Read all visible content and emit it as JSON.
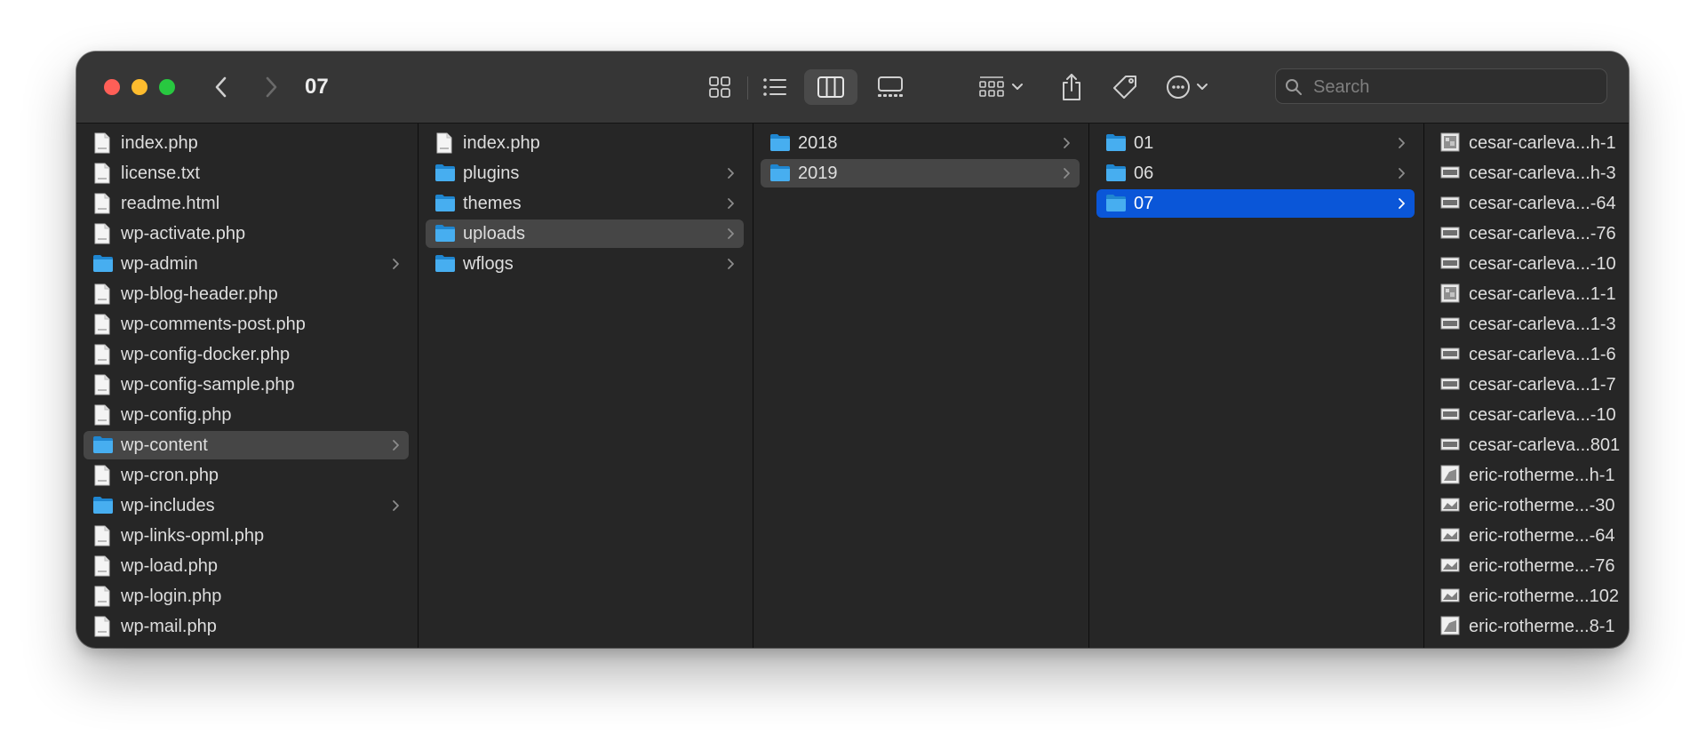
{
  "window": {
    "title": "07"
  },
  "search": {
    "placeholder": "Search"
  },
  "toolbar": {
    "view_icons": [
      "icon-view-icon",
      "list-view-icon",
      "column-view-icon",
      "gallery-view-icon"
    ],
    "group_icon": "group-by-icon",
    "share_icon": "share-icon",
    "tag_icon": "tag-icon",
    "more_icon": "more-actions-icon"
  },
  "colors": {
    "selection_blue": "#0a56d8",
    "selection_gray": "#464646",
    "folder": "#3aa6e8"
  },
  "columns": [
    {
      "items": [
        {
          "name": "index.php",
          "kind": "file"
        },
        {
          "name": "license.txt",
          "kind": "file"
        },
        {
          "name": "readme.html",
          "kind": "file"
        },
        {
          "name": "wp-activate.php",
          "kind": "file"
        },
        {
          "name": "wp-admin",
          "kind": "folder"
        },
        {
          "name": "wp-blog-header.php",
          "kind": "file"
        },
        {
          "name": "wp-comments-post.php",
          "kind": "file"
        },
        {
          "name": "wp-config-docker.php",
          "kind": "file"
        },
        {
          "name": "wp-config-sample.php",
          "kind": "file"
        },
        {
          "name": "wp-config.php",
          "kind": "file"
        },
        {
          "name": "wp-content",
          "kind": "folder",
          "state": "selected-inactive"
        },
        {
          "name": "wp-cron.php",
          "kind": "file"
        },
        {
          "name": "wp-includes",
          "kind": "folder"
        },
        {
          "name": "wp-links-opml.php",
          "kind": "file"
        },
        {
          "name": "wp-load.php",
          "kind": "file"
        },
        {
          "name": "wp-login.php",
          "kind": "file"
        },
        {
          "name": "wp-mail.php",
          "kind": "file"
        }
      ]
    },
    {
      "items": [
        {
          "name": "index.php",
          "kind": "file"
        },
        {
          "name": "plugins",
          "kind": "folder"
        },
        {
          "name": "themes",
          "kind": "folder"
        },
        {
          "name": "uploads",
          "kind": "folder",
          "state": "selected-inactive"
        },
        {
          "name": "wflogs",
          "kind": "folder"
        }
      ]
    },
    {
      "items": [
        {
          "name": "2018",
          "kind": "folder"
        },
        {
          "name": "2019",
          "kind": "folder",
          "state": "selected-inactive"
        }
      ]
    },
    {
      "items": [
        {
          "name": "01",
          "kind": "folder"
        },
        {
          "name": "06",
          "kind": "folder"
        },
        {
          "name": "07",
          "kind": "folder",
          "state": "selected-active"
        }
      ]
    },
    {
      "items": [
        {
          "name": "cesar-carleva...h-1",
          "kind": "image-thumb-a"
        },
        {
          "name": "cesar-carleva...h-3",
          "kind": "image-thumb-b"
        },
        {
          "name": "cesar-carleva...-64",
          "kind": "image-thumb-b"
        },
        {
          "name": "cesar-carleva...-76",
          "kind": "image-thumb-b"
        },
        {
          "name": "cesar-carleva...-10",
          "kind": "image-thumb-b"
        },
        {
          "name": "cesar-carleva...1-1",
          "kind": "image-thumb-a"
        },
        {
          "name": "cesar-carleva...1-3",
          "kind": "image-thumb-b"
        },
        {
          "name": "cesar-carleva...1-6",
          "kind": "image-thumb-b"
        },
        {
          "name": "cesar-carleva...1-7",
          "kind": "image-thumb-b"
        },
        {
          "name": "cesar-carleva...-10",
          "kind": "image-thumb-b"
        },
        {
          "name": "cesar-carleva...801",
          "kind": "image-thumb-b"
        },
        {
          "name": "eric-rotherme...h-1",
          "kind": "image-thumb-c"
        },
        {
          "name": "eric-rotherme...-30",
          "kind": "image-thumb-d"
        },
        {
          "name": "eric-rotherme...-64",
          "kind": "image-thumb-d"
        },
        {
          "name": "eric-rotherme...-76",
          "kind": "image-thumb-d"
        },
        {
          "name": "eric-rotherme...102",
          "kind": "image-thumb-d"
        },
        {
          "name": "eric-rotherme...8-1",
          "kind": "image-thumb-c"
        }
      ]
    }
  ]
}
